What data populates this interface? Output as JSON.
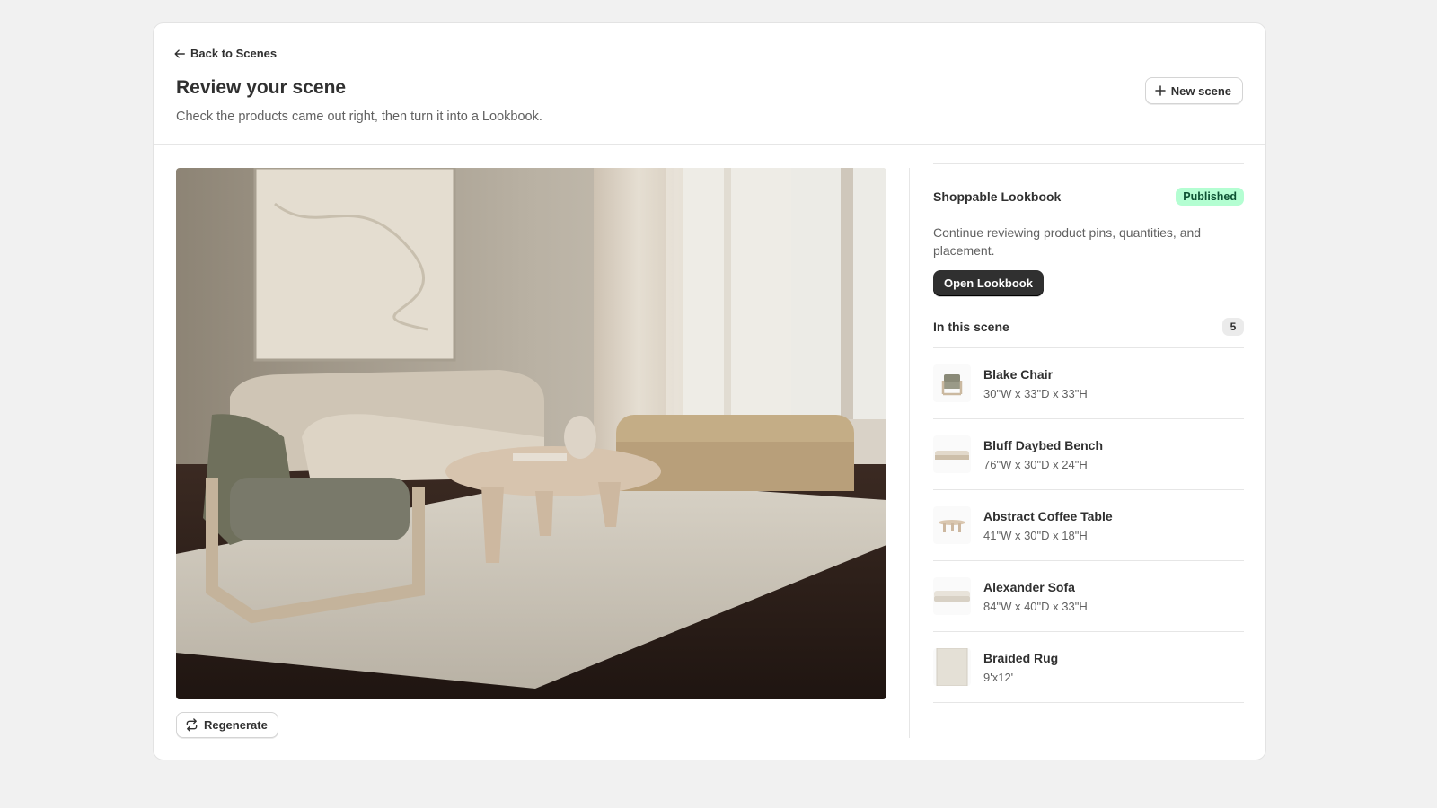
{
  "header": {
    "back_label": "Back to Scenes",
    "title": "Review your scene",
    "subtitle": "Check the products came out right, then turn it into a Lookbook.",
    "new_scene_label": "New scene"
  },
  "scene": {
    "image_icon": "living-room-scene-photo",
    "regenerate_label": "Regenerate"
  },
  "lookbook": {
    "title": "Shoppable Lookbook",
    "status": "Published",
    "status_color": "#b4fed2",
    "description": "Continue reviewing product pins, quantities, and placement.",
    "open_label": "Open Lookbook"
  },
  "products_section": {
    "title": "In this scene",
    "count": "5",
    "items": [
      {
        "name": "Blake Chair",
        "dims": "30\"W x 33\"D x 33\"H",
        "icon": "chair-thumbnail"
      },
      {
        "name": "Bluff Daybed Bench",
        "dims": "76\"W x 30\"D x 24\"H",
        "icon": "bench-thumbnail"
      },
      {
        "name": "Abstract Coffee Table",
        "dims": "41\"W x 30\"D x 18\"H",
        "icon": "coffee-table-thumbnail"
      },
      {
        "name": "Alexander Sofa",
        "dims": "84\"W x 40\"D x 33\"H",
        "icon": "sofa-thumbnail"
      },
      {
        "name": "Braided Rug",
        "dims": "9'x12'",
        "icon": "rug-thumbnail"
      }
    ]
  },
  "colors": {
    "primary_button": "#303030",
    "background": "#f1f1f1"
  }
}
